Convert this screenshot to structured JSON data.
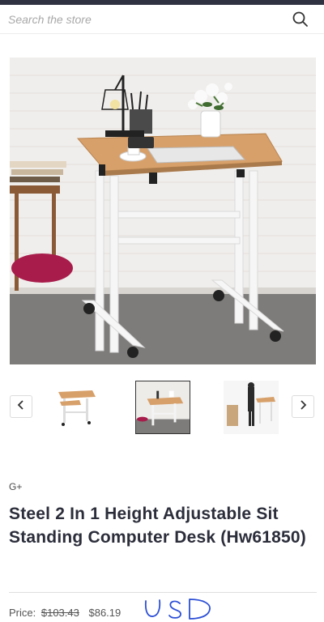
{
  "search": {
    "placeholder": "Search the store",
    "icon": "search-icon"
  },
  "product": {
    "brand": "G+",
    "title": "Steel 2 In 1 Height Adjustable Sit Standing Computer Desk (Hw61850)",
    "price_label": "Price:",
    "original_price": "$103.43",
    "sale_price": "$86.19",
    "handwritten_note": "USD"
  },
  "gallery": {
    "selected_index": 1,
    "thumbnails": [
      "desk-thumbnail-1",
      "desk-thumbnail-2",
      "desk-thumbnail-3"
    ],
    "prev_icon": "chevron-left-icon",
    "next_icon": "chevron-right-icon"
  },
  "colors": {
    "topbar": "#2f3241",
    "text": "#2b2d3a",
    "desk_top": "#d7a06a",
    "desk_frame": "#f4f4f4"
  }
}
